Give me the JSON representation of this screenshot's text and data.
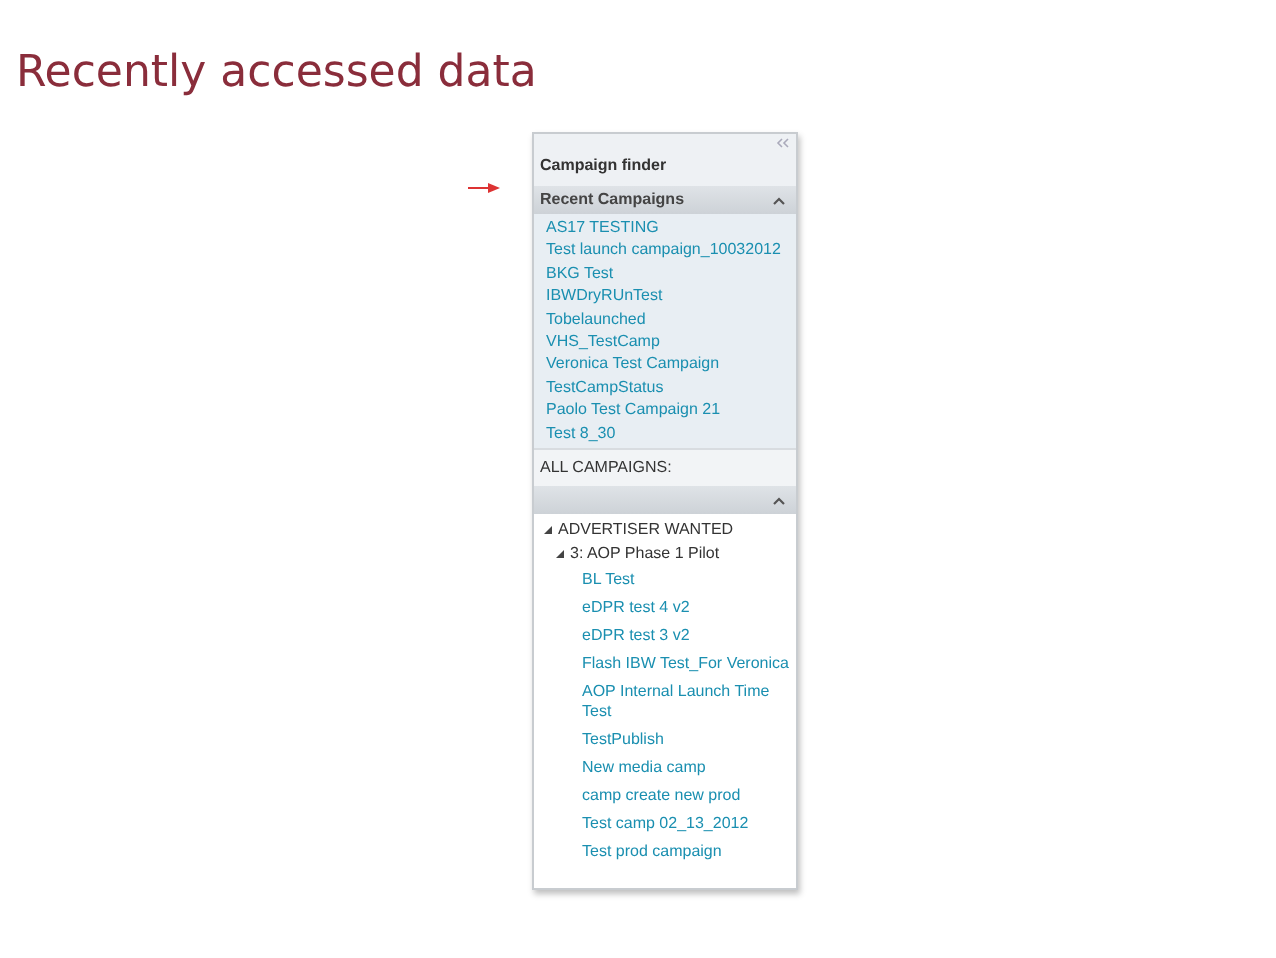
{
  "title": "Recently accessed data",
  "panel": {
    "title": "Campaign finder",
    "recent": {
      "label": "Recent Campaigns",
      "expanded": true,
      "items": [
        "AS17 TESTING",
        "Test launch campaign_10032012",
        "BKG Test",
        "IBWDryRUnTest",
        "Tobelaunched",
        "VHS_TestCamp",
        "Veronica Test Campaign",
        "TestCampStatus",
        "Paolo Test Campaign 21",
        "Test 8_30"
      ]
    },
    "all": {
      "label": "ALL CAMPAIGNS:",
      "expanded": true,
      "tree": [
        {
          "label": "ADVERTISER WANTED",
          "expanded": true,
          "children": [
            {
              "label": "3: AOP Phase 1 Pilot",
              "expanded": true,
              "children": [
                {
                  "label": "BL Test"
                },
                {
                  "label": "eDPR test 4 v2"
                },
                {
                  "label": "eDPR test 3 v2"
                },
                {
                  "label": "Flash IBW Test_For Veronica"
                },
                {
                  "label": "AOP Internal Launch Time Test"
                },
                {
                  "label": "TestPublish"
                },
                {
                  "label": "New media camp"
                },
                {
                  "label": "camp create new prod"
                },
                {
                  "label": "Test camp 02_13_2012"
                },
                {
                  "label": "Test prod campaign"
                }
              ]
            }
          ]
        }
      ]
    }
  }
}
